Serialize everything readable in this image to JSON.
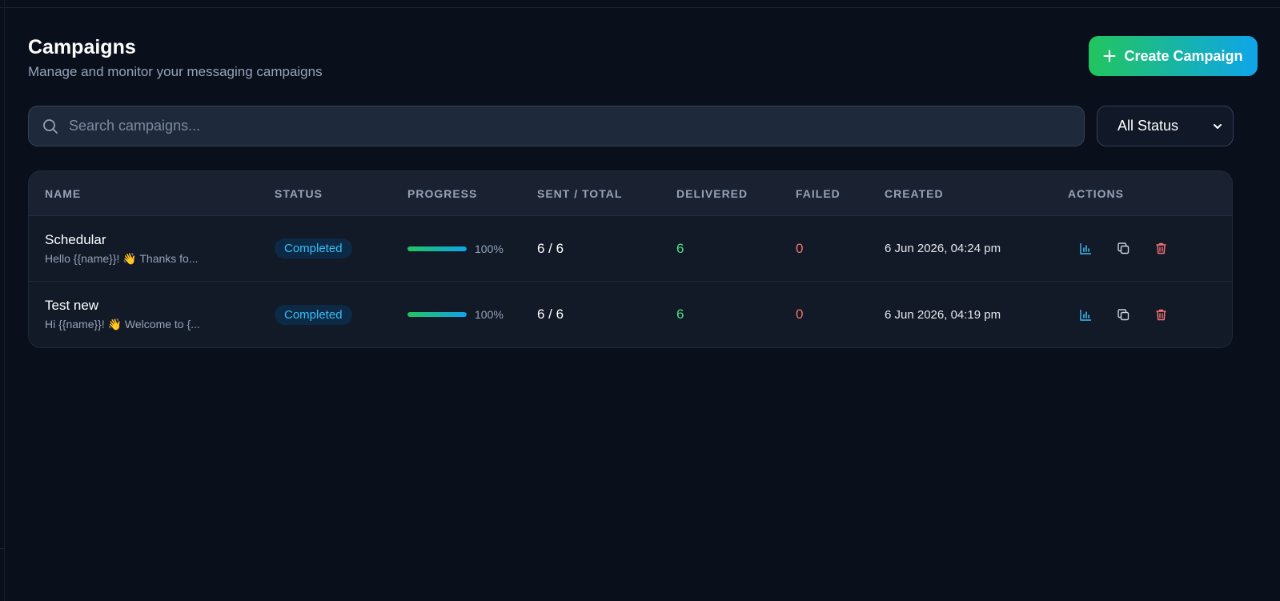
{
  "header": {
    "title": "Campaigns",
    "subtitle": "Manage and monitor your messaging campaigns",
    "create_button_label": "Create Campaign"
  },
  "search": {
    "placeholder": "Search campaigns...",
    "value": ""
  },
  "status_filter": {
    "selected": "All Status"
  },
  "table": {
    "columns": [
      "Name",
      "Status",
      "Progress",
      "Sent / Total",
      "Delivered",
      "Failed",
      "Created",
      "Actions"
    ],
    "rows": [
      {
        "name": "Schedular",
        "preview": "Hello {{name}}! 👋 Thanks fo...",
        "status": "Completed",
        "progress": 1.0,
        "progress_label": "100%",
        "sent_total": "6 / 6",
        "delivered": "6",
        "failed": "0",
        "created": "6 Jun 2026, 04:24 pm"
      },
      {
        "name": "Test new",
        "preview": "Hi {{name}}! 👋 Welcome to {...",
        "status": "Completed",
        "progress": 1.0,
        "progress_label": "100%",
        "sent_total": "6 / 6",
        "delivered": "6",
        "failed": "0",
        "created": "6 Jun 2026, 04:19 pm"
      }
    ]
  },
  "colors": {
    "background": "#0a0f1c",
    "accent_green": "#22c55e",
    "accent_blue": "#0ea5e9",
    "delivered": "#4ade80",
    "failed": "#f87171",
    "badge_text": "#38bdf8"
  },
  "icons": {
    "create": "plus-icon",
    "search": "search-icon",
    "select": "chevron-down-icon",
    "row_actions": [
      "bar-chart-icon",
      "copy-icon",
      "trash-icon"
    ]
  }
}
